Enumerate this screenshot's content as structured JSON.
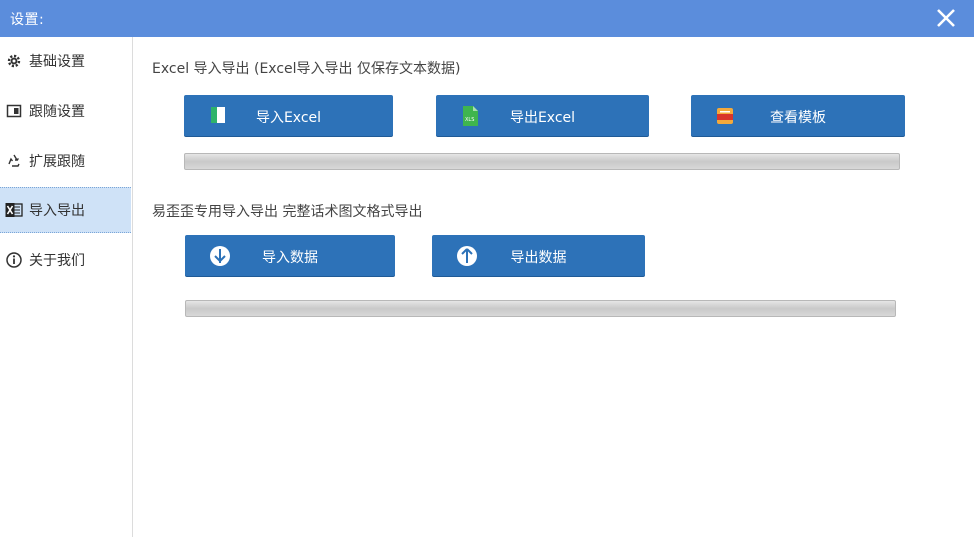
{
  "window": {
    "title": "设置:"
  },
  "sidebar": {
    "items": [
      {
        "label": "基础设置",
        "icon": "gear-icon"
      },
      {
        "label": "跟随设置",
        "icon": "window-icon"
      },
      {
        "label": "扩展跟随",
        "icon": "recycle-icon"
      },
      {
        "label": "导入导出",
        "icon": "excel-icon",
        "active": true
      },
      {
        "label": "关于我们",
        "icon": "info-icon"
      }
    ]
  },
  "excel_section": {
    "title": "Excel 导入导出 (Excel导入导出 仅保存文本数据)",
    "buttons": {
      "import": "导入Excel",
      "export": "导出Excel",
      "template": "查看模板"
    },
    "progress": 0
  },
  "custom_section": {
    "title": "易歪歪专用导入导出 完整话术图文格式导出",
    "buttons": {
      "import": "导入数据",
      "export": "导出数据"
    },
    "progress": 0
  },
  "colors": {
    "titlebar": "#5b8ddc",
    "button": "#2d72b8",
    "active_nav": "#cfe2f7"
  }
}
